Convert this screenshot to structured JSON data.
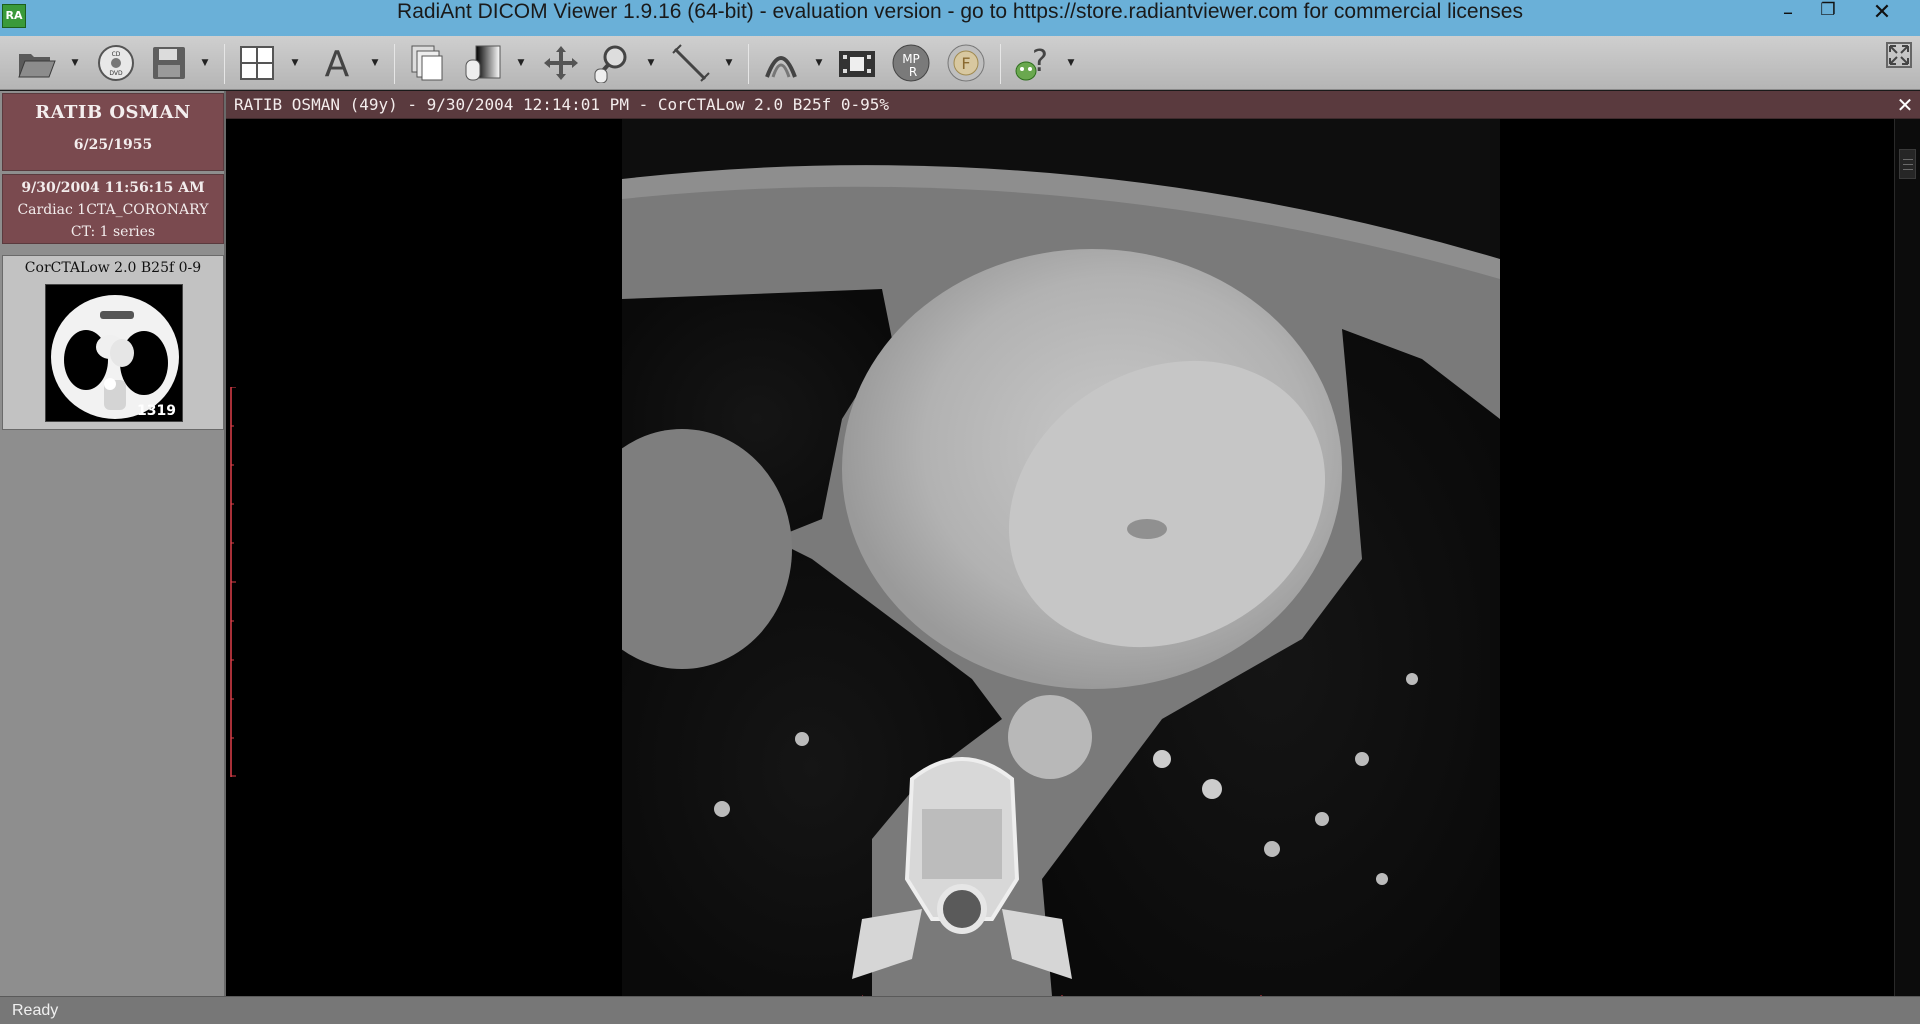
{
  "window": {
    "title": "RadiAnt DICOM Viewer 1.9.16 (64-bit) - evaluation version - go to https://store.radiantviewer.com for commercial licenses",
    "app_icon_text": "RA"
  },
  "toolbar": {
    "icons": [
      "open-folder-icon",
      "cd-dvd-icon",
      "save-disk-icon",
      "layout-grid-icon",
      "text-annotation-icon",
      "series-stack-icon",
      "window-level-icon",
      "pan-move-icon",
      "zoom-magnifier-icon",
      "measure-ruler-icon",
      "fusion-filter-icon",
      "cine-film-icon",
      "mpr-icon",
      "fusion-f-icon",
      "help-icon"
    ],
    "cd_label": "CD DVD",
    "mpr_label": "MPR",
    "fusion_label": "F"
  },
  "patient": {
    "name": "RATIB OSMAN",
    "dob": "6/25/1955"
  },
  "study": {
    "datetime": "9/30/2004 11:56:15 AM",
    "description": "Cardiac 1CTA_CORONARY",
    "series_count": "CT: 1 series"
  },
  "series": {
    "label": "CorCTALow  2.0  B25f 0-9",
    "image_count": "1319"
  },
  "viewer": {
    "header": "RATIB OSMAN (49y) - 9/30/2004 12:14:01 PM - CorCTALow  2.0  B25f 0-95%",
    "close_symbol": "✕"
  },
  "status": {
    "text": "Ready"
  },
  "colors": {
    "titlebar": "#6ab0d8",
    "patient_card": "#7a4a4f",
    "viewer_header": "#5a3a3e",
    "ruler": "#e0404a"
  }
}
